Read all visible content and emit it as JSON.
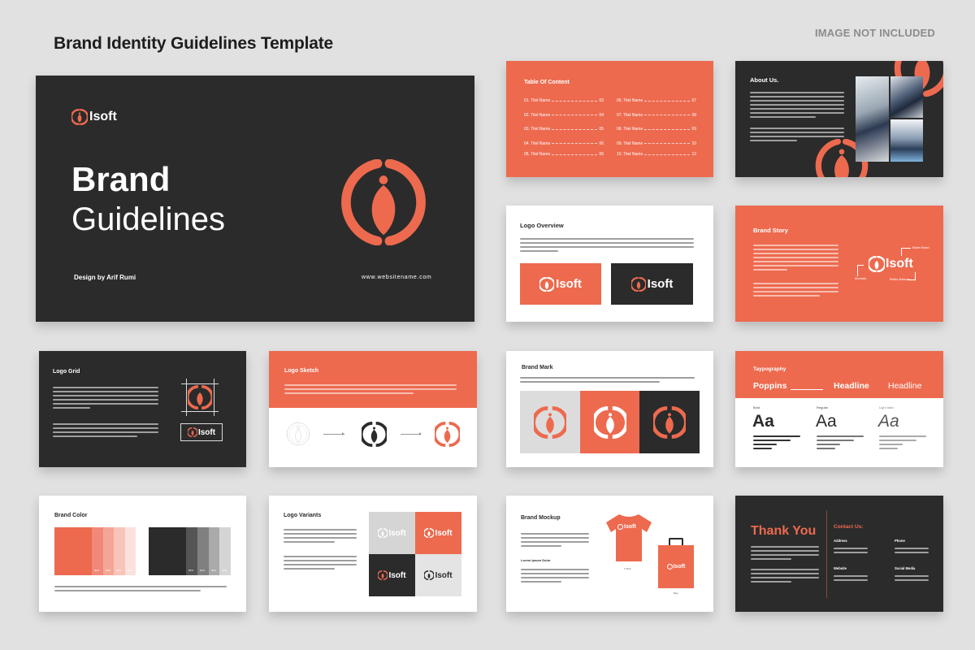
{
  "header": {
    "title": "Brand Identity Guidelines Template",
    "notice": "IMAGE NOT INCLUDED"
  },
  "colors": {
    "coral": "#ed6a4f",
    "dark": "#2b2b2b",
    "light_gray": "#dcdcdc",
    "white": "#ffffff"
  },
  "brand": {
    "logo_text": "Isoft",
    "logo_icon": "isoft-emblem-icon"
  },
  "cover": {
    "title_line1": "Brand",
    "title_line2": "Guidelines",
    "designer": "Design by Arif Rumi",
    "website": "www.websitename.com"
  },
  "toc": {
    "title": "Table Of Content",
    "items": [
      {
        "label": "01. Titel Name",
        "page": "03"
      },
      {
        "label": "02. Titel Name",
        "page": "04"
      },
      {
        "label": "03. Titel Name",
        "page": "05"
      },
      {
        "label": "04. Titel Name",
        "page": "06"
      },
      {
        "label": "05. Titel Name",
        "page": "06"
      },
      {
        "label": "06. Titel Name",
        "page": "07"
      },
      {
        "label": "07. Titel Name",
        "page": "08"
      },
      {
        "label": "08. Titel Name",
        "page": "09"
      },
      {
        "label": "09. Titel Name",
        "page": "10"
      },
      {
        "label": "10. Titel Name",
        "page": "12"
      }
    ]
  },
  "about": {
    "title": "About Us."
  },
  "logo_overview": {
    "title": "Logo Overview"
  },
  "brand_story": {
    "title": "Brand Story",
    "annotations": [
      "Bolder Brand",
      "Mountain",
      "Radius Balance"
    ]
  },
  "logo_grid": {
    "title": "Logo Grid"
  },
  "logo_sketch": {
    "title": "Logo Sketch"
  },
  "brand_mark": {
    "title": "Brand Mark"
  },
  "typography": {
    "title": "Taypography",
    "font_name": "Poppins",
    "headline_bold": "Headline",
    "headline_light": "Headline",
    "weights": [
      {
        "label": "Bold",
        "sample": "Aa"
      },
      {
        "label": "Regular",
        "sample": "Aa"
      },
      {
        "label": "Light Italic",
        "sample": "Aa"
      }
    ]
  },
  "brand_color": {
    "title": "Brand Color",
    "primary_tints": [
      "80%",
      "60%",
      "40%",
      "20%"
    ],
    "secondary_tints": [
      "80%",
      "60%",
      "40%",
      "20%"
    ]
  },
  "logo_variants": {
    "title": "Logo Variants"
  },
  "brand_mockup": {
    "title": "Brand Mockup",
    "subtitle": "Lorem Ipsum Dolor",
    "items": [
      "T-Shirt",
      "Bag"
    ]
  },
  "thank_you": {
    "title": "Thank You",
    "contact_title": "Contact Us:",
    "fields": [
      "Address",
      "Phone",
      "Website",
      "Social Media"
    ]
  }
}
